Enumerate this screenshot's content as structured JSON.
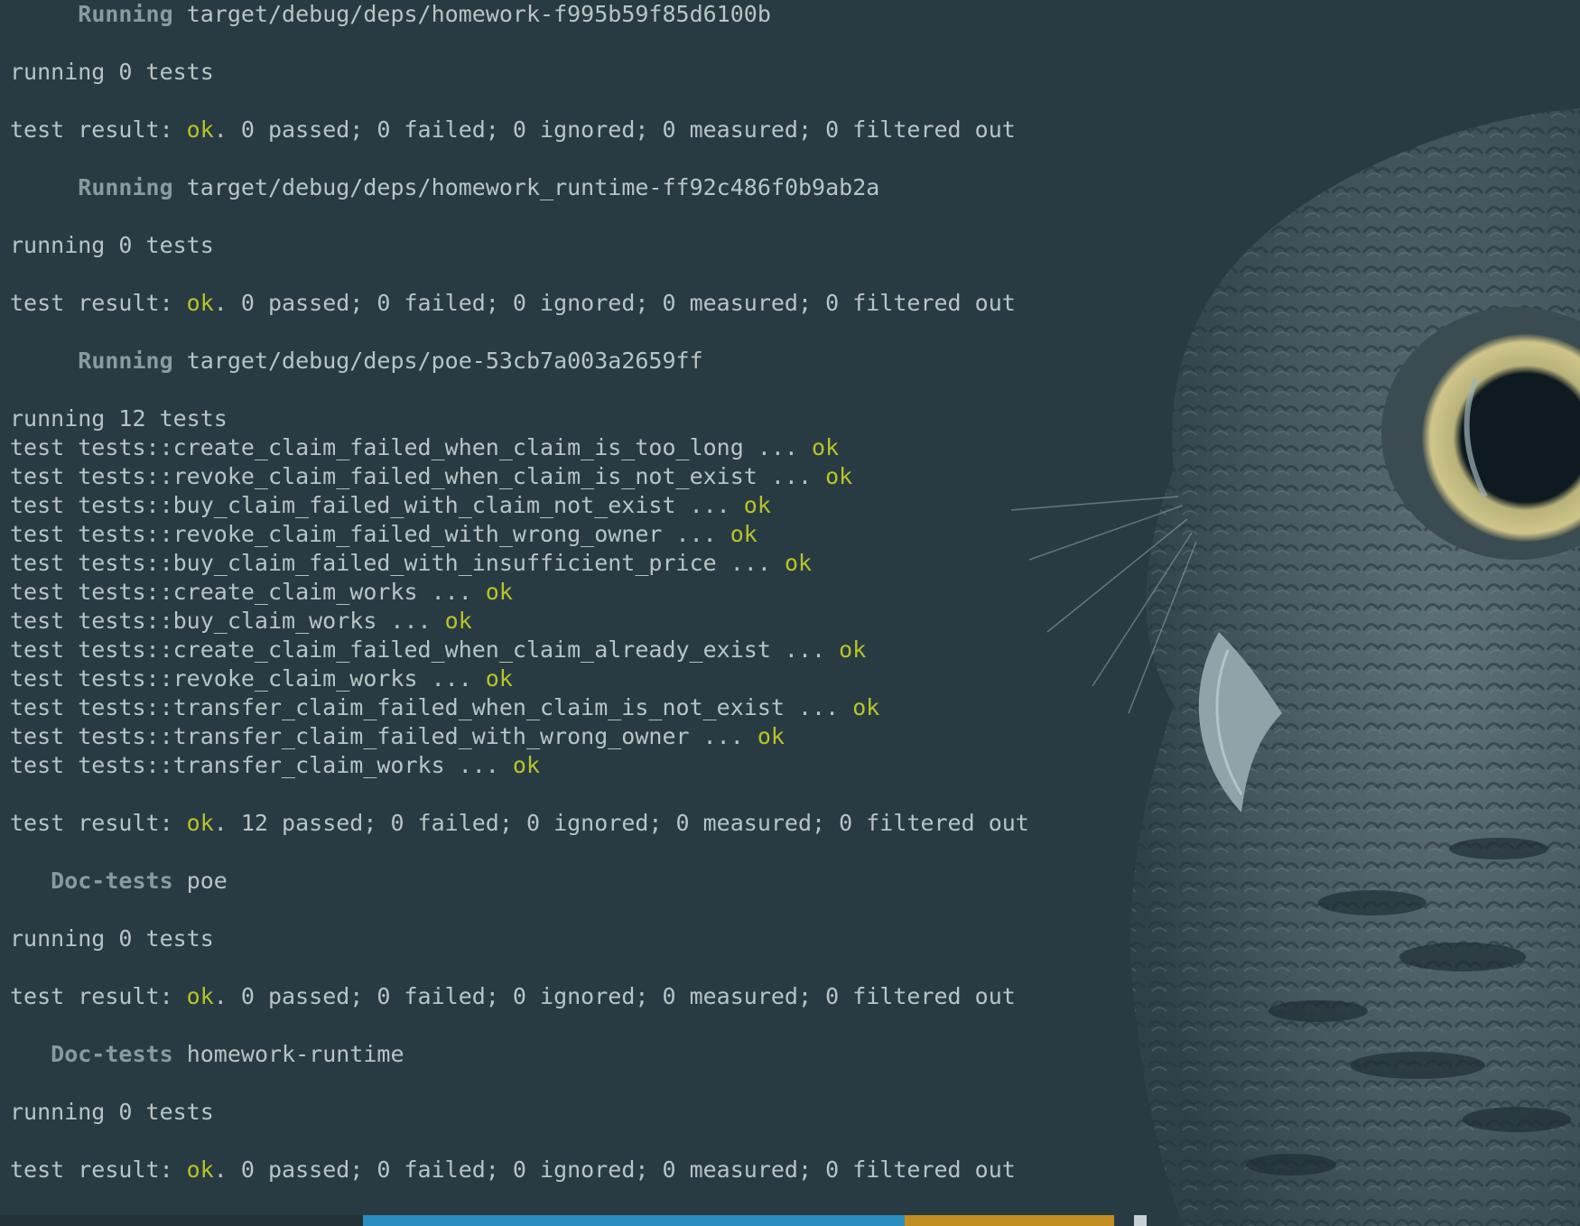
{
  "terminal": {
    "blocks": [
      {
        "kind": "runner",
        "label": "Running",
        "target": "target/debug/deps/homework-f995b59f85d6100b"
      },
      {
        "kind": "blank"
      },
      {
        "kind": "plain",
        "text": "running 0 tests"
      },
      {
        "kind": "blank"
      },
      {
        "kind": "result",
        "prefix": "test result: ",
        "status": "ok",
        "suffix": ". 0 passed; 0 failed; 0 ignored; 0 measured; 0 filtered out"
      },
      {
        "kind": "blank"
      },
      {
        "kind": "runner",
        "label": "Running",
        "target": "target/debug/deps/homework_runtime-ff92c486f0b9ab2a"
      },
      {
        "kind": "blank"
      },
      {
        "kind": "plain",
        "text": "running 0 tests"
      },
      {
        "kind": "blank"
      },
      {
        "kind": "result",
        "prefix": "test result: ",
        "status": "ok",
        "suffix": ". 0 passed; 0 failed; 0 ignored; 0 measured; 0 filtered out"
      },
      {
        "kind": "blank"
      },
      {
        "kind": "runner",
        "label": "Running",
        "target": "target/debug/deps/poe-53cb7a003a2659ff"
      },
      {
        "kind": "blank"
      },
      {
        "kind": "plain",
        "text": "running 12 tests"
      },
      {
        "kind": "test",
        "name": "test tests::create_claim_failed_when_claim_is_too_long ... ",
        "status": "ok"
      },
      {
        "kind": "test",
        "name": "test tests::revoke_claim_failed_when_claim_is_not_exist ... ",
        "status": "ok"
      },
      {
        "kind": "test",
        "name": "test tests::buy_claim_failed_with_claim_not_exist ... ",
        "status": "ok"
      },
      {
        "kind": "test",
        "name": "test tests::revoke_claim_failed_with_wrong_owner ... ",
        "status": "ok"
      },
      {
        "kind": "test",
        "name": "test tests::buy_claim_failed_with_insufficient_price ... ",
        "status": "ok"
      },
      {
        "kind": "test",
        "name": "test tests::create_claim_works ... ",
        "status": "ok"
      },
      {
        "kind": "test",
        "name": "test tests::buy_claim_works ... ",
        "status": "ok"
      },
      {
        "kind": "test",
        "name": "test tests::create_claim_failed_when_claim_already_exist ... ",
        "status": "ok"
      },
      {
        "kind": "test",
        "name": "test tests::revoke_claim_works ... ",
        "status": "ok"
      },
      {
        "kind": "test",
        "name": "test tests::transfer_claim_failed_when_claim_is_not_exist ... ",
        "status": "ok"
      },
      {
        "kind": "test",
        "name": "test tests::transfer_claim_failed_with_wrong_owner ... ",
        "status": "ok"
      },
      {
        "kind": "test",
        "name": "test tests::transfer_claim_works ... ",
        "status": "ok"
      },
      {
        "kind": "blank"
      },
      {
        "kind": "result",
        "prefix": "test result: ",
        "status": "ok",
        "suffix": ". 12 passed; 0 failed; 0 ignored; 0 measured; 0 filtered out"
      },
      {
        "kind": "blank"
      },
      {
        "kind": "doctest",
        "label": "Doc-tests",
        "target": "poe"
      },
      {
        "kind": "blank"
      },
      {
        "kind": "plain",
        "text": "running 0 tests"
      },
      {
        "kind": "blank"
      },
      {
        "kind": "result",
        "prefix": "test result: ",
        "status": "ok",
        "suffix": ". 0 passed; 0 failed; 0 ignored; 0 measured; 0 filtered out"
      },
      {
        "kind": "blank"
      },
      {
        "kind": "doctest",
        "label": "Doc-tests",
        "target": "homework-runtime"
      },
      {
        "kind": "blank"
      },
      {
        "kind": "plain",
        "text": "running 0 tests"
      },
      {
        "kind": "blank"
      },
      {
        "kind": "result",
        "prefix": "test result: ",
        "status": "ok",
        "suffix": ". 0 passed; 0 failed; 0 ignored; 0 measured; 0 filtered out"
      }
    ]
  },
  "status_bar": {
    "host": "",
    "path": "",
    "git": ""
  },
  "colors": {
    "background": "#293b42",
    "text": "#b8c4c6",
    "ok": "#b7c429",
    "label": "#8a9a9e",
    "status_path": "#2a8fc0",
    "status_git": "#c38e22"
  }
}
